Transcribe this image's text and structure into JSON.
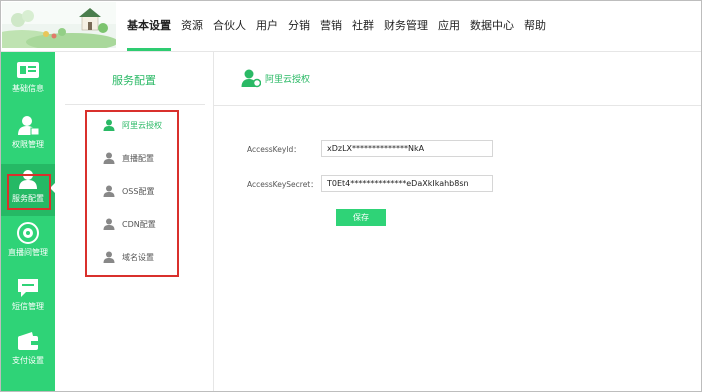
{
  "nav": {
    "items": [
      "基本设置",
      "资源",
      "合伙人",
      "用户",
      "分销",
      "营销",
      "社群",
      "财务管理",
      "应用",
      "数据中心",
      "帮助"
    ],
    "active_index": 0
  },
  "sidebar": {
    "items": [
      {
        "label": "基础信息",
        "icon": "card-icon"
      },
      {
        "label": "权限管理",
        "icon": "user-lock-icon"
      },
      {
        "label": "服务配置",
        "icon": "user-service-icon"
      },
      {
        "label": "直播间管理",
        "icon": "live-disc-icon"
      },
      {
        "label": "短信管理",
        "icon": "chat-bubble-icon"
      },
      {
        "label": "支付设置",
        "icon": "wallet-icon"
      }
    ],
    "active_index": 2
  },
  "submenu": {
    "title": "服务配置",
    "items": [
      "阿里云授权",
      "直播配置",
      "OSS配置",
      "CDN配置",
      "域名设置"
    ],
    "active_index": 0
  },
  "main": {
    "title": "阿里云授权",
    "access_key_id_label": "AccessKeyId：",
    "access_key_id_value": "xDzLX**************NkA",
    "access_key_secret_label": "AccessKeySecret：",
    "access_key_secret_value": "T0Et4**************eDaXkIkahb8sn",
    "save_label": "保存"
  },
  "colors": {
    "accent": "#2fd377",
    "accent_dark": "#25b965",
    "highlight_box": "#d9302c"
  }
}
